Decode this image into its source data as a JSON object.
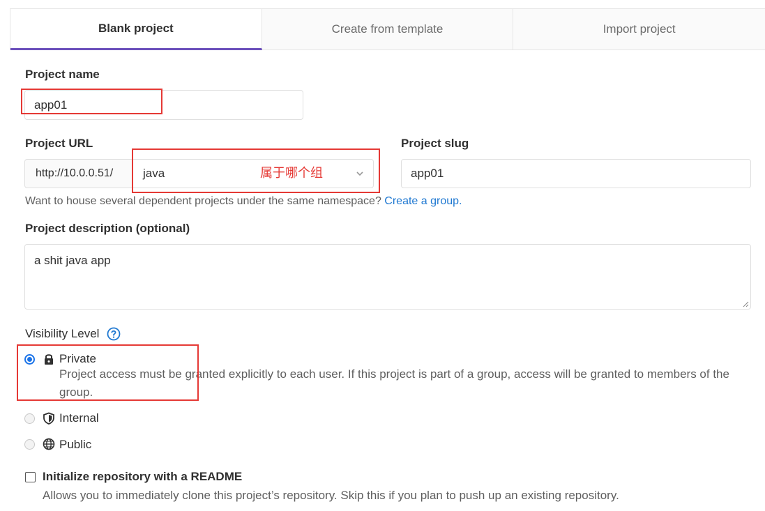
{
  "tabs": [
    {
      "label": "Blank project",
      "active": true
    },
    {
      "label": "Create from template",
      "active": false
    },
    {
      "label": "Import project",
      "active": false
    }
  ],
  "project_name": {
    "label": "Project name",
    "value": "app01"
  },
  "project_url": {
    "label": "Project URL",
    "prefix": "http://10.0.0.51/",
    "namespace": "java"
  },
  "project_slug": {
    "label": "Project slug",
    "value": "app01"
  },
  "namespace_help": {
    "text": "Want to house several dependent projects under the same namespace?",
    "link": "Create a group."
  },
  "description": {
    "label": "Project description (optional)",
    "value": "a shit java app"
  },
  "visibility": {
    "label": "Visibility Level",
    "help_icon": "question-circle-icon",
    "options": [
      {
        "title": "Private",
        "icon": "lock-icon",
        "selected": true,
        "description": "Project access must be granted explicitly to each user. If this project is part of a group, access will be granted to members of the group."
      },
      {
        "title": "Internal",
        "icon": "shield-icon",
        "selected": false
      },
      {
        "title": "Public",
        "icon": "globe-icon",
        "selected": false
      }
    ]
  },
  "readme": {
    "label": "Initialize repository with a README",
    "checked": false,
    "description": "Allows you to immediately clone this project’s repository. Skip this if you plan to push up an existing repository."
  },
  "annotation": {
    "text": "属于哪个组"
  },
  "colors": {
    "accent": "#6b4fbb",
    "link": "#1f78d1",
    "annotation": "#e53935",
    "radio": "#1a73e8"
  }
}
